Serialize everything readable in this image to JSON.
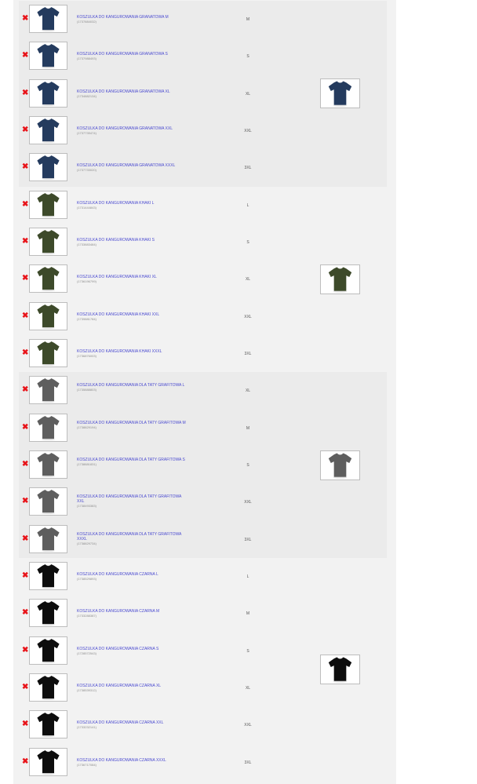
{
  "groups": [
    {
      "color_name": "granatowa",
      "shirt_color": "#243b5e",
      "shaded": true,
      "items": [
        {
          "name": "KOSZULKA DO KANGUROWANIA GRANATOWA M",
          "code": "(1737884032)",
          "size": "M"
        },
        {
          "name": "KOSZULKA DO KANGUROWANIA GRANATOWA S",
          "code": "(1737988493)",
          "size": "S"
        },
        {
          "name": "KOSZULKA DO KANGUROWANIA GRANATOWA XL",
          "code": "(1734882134)",
          "size": "XL"
        },
        {
          "name": "KOSZULKA DO KANGUROWANIA GRANATOWA XXL",
          "code": "(1737739474)",
          "size": "XXL"
        },
        {
          "name": "KOSZULKA DO KANGUROWANIA GRANATOWA XXXL",
          "code": "(1737733020)",
          "size": "3XL"
        }
      ]
    },
    {
      "color_name": "khaki",
      "shirt_color": "#3d4a2a",
      "shaded": false,
      "items": [
        {
          "name": "KOSZULKA DO KANGUROWANIA KHAKI L",
          "code": "(1731444843)",
          "size": "L"
        },
        {
          "name": "KOSZULKA DO KANGUROWANIA KHAKI S",
          "code": "(1733883484)",
          "size": "S"
        },
        {
          "name": "KOSZULKA DO KANGUROWANIA KHAKI XL",
          "code": "(1736196799)",
          "size": "XL"
        },
        {
          "name": "KOSZULKA DO KANGUROWANIA KHAKI XXL",
          "code": "(1739881784)",
          "size": "XXL"
        },
        {
          "name": "KOSZULKA DO KANGUROWANIA KHAKI XXXL",
          "code": "(1736876003)",
          "size": "3XL"
        }
      ]
    },
    {
      "color_name": "grafitowa",
      "shirt_color": "#5e5e5e",
      "shaded": true,
      "items": [
        {
          "name": "KOSZULKA DO KANGUROWANIA DLA TATY GRAFITOWA L",
          "code": "(1735888803)",
          "size": "XL"
        },
        {
          "name": "KOSZULKA DO KANGUROWANIA DLA TATY GRAFITOWA M",
          "code": "(1738829194)",
          "size": "M"
        },
        {
          "name": "KOSZULKA DO KANGUROWANIA DLA TATY GRAFITOWA S",
          "code": "(1738881831)",
          "size": "S"
        },
        {
          "name": "KOSZULKA DO KANGUROWANIA DLA TATY GRAFITOWA XXL",
          "code": "(1738493383)",
          "size": "XXL"
        },
        {
          "name": "KOSZULKA DO KANGUROWANIA DLA TATY GRAFITOWA XXXL",
          "code": "(1738829734)",
          "size": "3XL"
        }
      ]
    },
    {
      "color_name": "czarna",
      "shirt_color": "#0d0d0d",
      "shaded": false,
      "items": [
        {
          "name": "KOSZULKA DO KANGUROWANIA CZARNA L",
          "code": "(1738529893)",
          "size": "L"
        },
        {
          "name": "KOSZULKA DO KANGUROWANIA CZARNA M",
          "code": "(1733288387)",
          "size": "M"
        },
        {
          "name": "KOSZULKA DO KANGUROWANIA CZARNA S",
          "code": "(1728572543)",
          "size": "S"
        },
        {
          "name": "KOSZULKA DO KANGUROWANIA CZARNA XL",
          "code": "(1738539312)",
          "size": "XL"
        },
        {
          "name": "KOSZULKA DO KANGUROWANIA CZARNA XXL",
          "code": "(1733232141)",
          "size": "XXL"
        },
        {
          "name": "KOSZULKA DO KANGUROWANIA CZARNA XXXL",
          "code": "(1736717084)",
          "size": "3XL"
        }
      ]
    }
  ],
  "icons": {
    "remove": "remove-icon",
    "shirt": "tshirt-icon"
  },
  "remove_glyph": "✖",
  "colors": {
    "remove": "#e8141a",
    "link": "#4a4ad0",
    "code": "#8c8c8c"
  }
}
